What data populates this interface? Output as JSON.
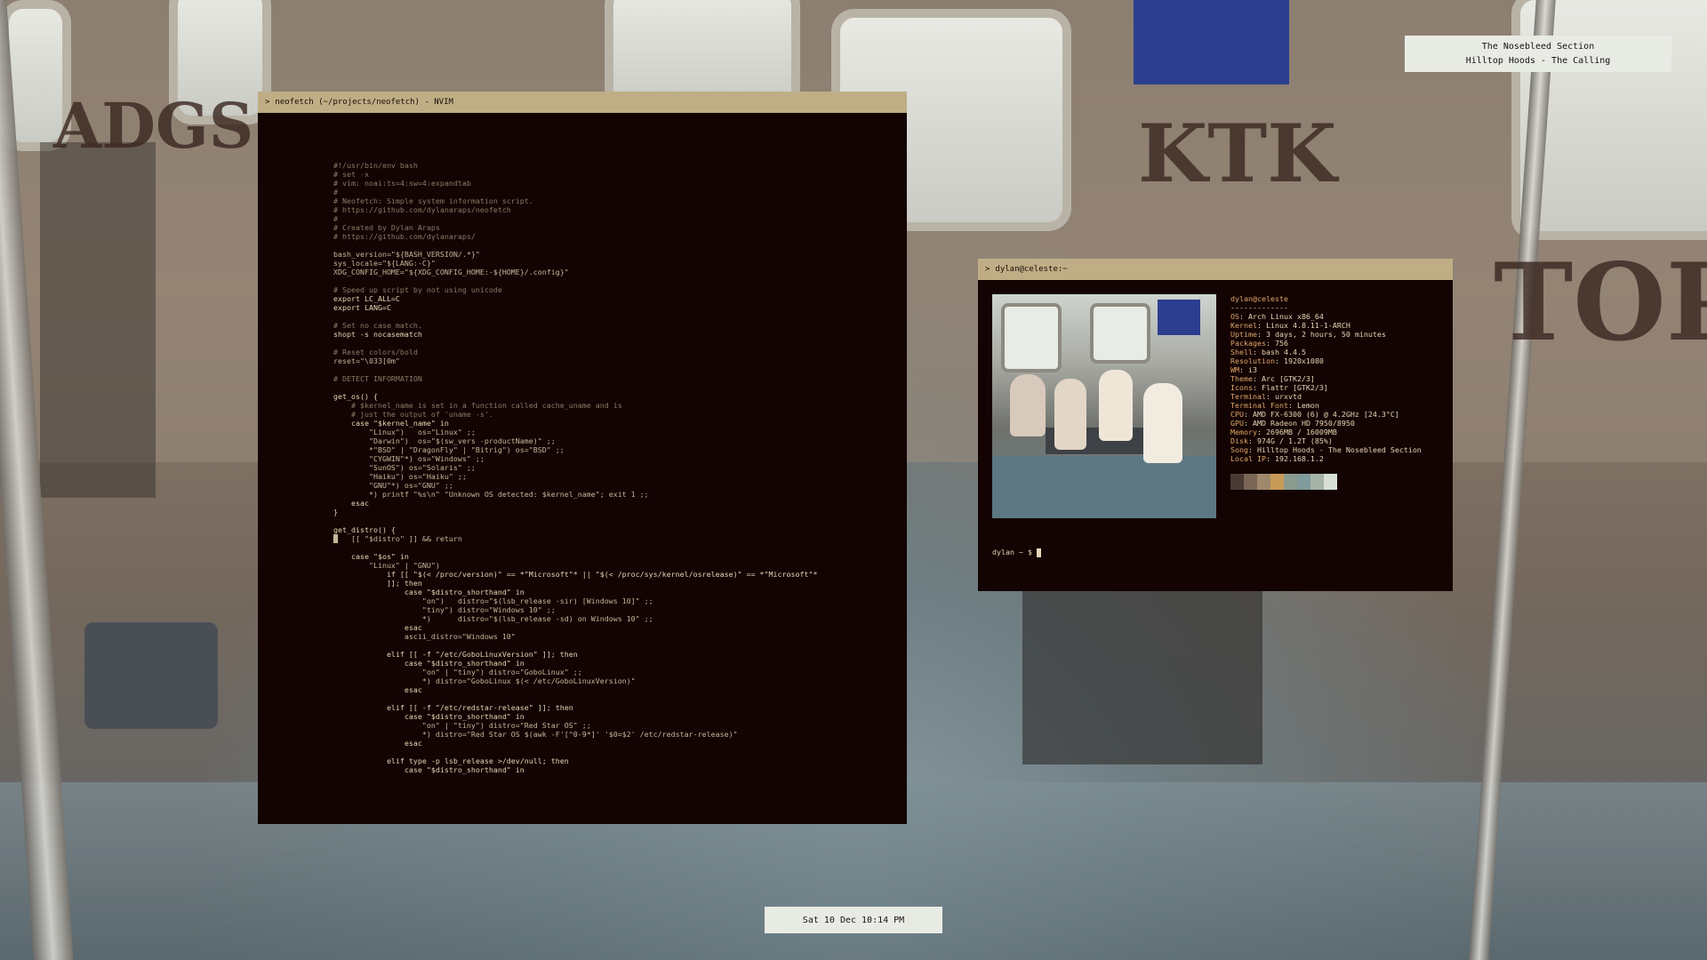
{
  "notification": {
    "line1": "The Nosebleed Section",
    "line2": "Hilltop Hoods - The Calling"
  },
  "clock": {
    "text": "Sat 10 Dec 10:14 PM"
  },
  "nvim": {
    "title_prefix": ">",
    "title": "neofetch (~/projects/neofetch) - NVIM"
  },
  "terminal": {
    "title_prefix": ">",
    "title": "dylan@celeste:~",
    "user_host": "dylan@celeste",
    "separator": "-------------",
    "info": [
      {
        "key": "OS",
        "value": "Arch Linux x86_64"
      },
      {
        "key": "Kernel",
        "value": "Linux 4.8.11-1-ARCH"
      },
      {
        "key": "Uptime",
        "value": "3 days, 2 hours, 50 minutes"
      },
      {
        "key": "Packages",
        "value": "756"
      },
      {
        "key": "Shell",
        "value": "bash 4.4.5"
      },
      {
        "key": "Resolution",
        "value": "1920x1080"
      },
      {
        "key": "WM",
        "value": "i3"
      },
      {
        "key": "Theme",
        "value": "Arc [GTK2/3]"
      },
      {
        "key": "Icons",
        "value": "Flattr [GTK2/3]"
      },
      {
        "key": "Terminal",
        "value": "urxvtd"
      },
      {
        "key": "Terminal Font",
        "value": "Lemon"
      },
      {
        "key": "CPU",
        "value": "AMD FX-6300 (6) @ 4.2GHz [24.3°C]"
      },
      {
        "key": "GPU",
        "value": "AMD Radeon HD 7950/8950"
      },
      {
        "key": "Memory",
        "value": "2696MB / 16009MB"
      },
      {
        "key": "Disk",
        "value": "974G / 1.2T (85%)"
      },
      {
        "key": "Song",
        "value": "Hilltop Hoods - The Nosebleed Section"
      },
      {
        "key": "Local IP",
        "value": "192.168.1.2"
      }
    ],
    "palette": [
      "#4a3a34",
      "#7a6656",
      "#a0886c",
      "#c89a58",
      "#8a9a8e",
      "#7f9a9a",
      "#a6b4a8",
      "#d8e0d6"
    ],
    "prompt": "dylan ~ $"
  },
  "code_lines": [
    "#!/usr/bin/env bash",
    "# set -x",
    "# vim: noai:ts=4:sw=4:expandtab",
    "#",
    "# Neofetch: Simple system information script.",
    "# https://github.com/dylanaraps/neofetch",
    "#",
    "# Created by Dylan Araps",
    "# https://github.com/dylanaraps/",
    "",
    "bash_version=\"${BASH_VERSION/.*}\"",
    "sys_locale=\"${LANG:-C}\"",
    "XDG_CONFIG_HOME=\"${XDG_CONFIG_HOME:-${HOME}/.config}\"",
    "",
    "# Speed up script by not using unicode",
    "export LC_ALL=C",
    "export LANG=C",
    "",
    "# Set no case match.",
    "shopt -s nocasematch",
    "",
    "# Reset colors/bold",
    "reset=\"\\033[0m\"",
    "",
    "# DETECT INFORMATION",
    "",
    "get_os() {",
    "    # $kernel_name is set in a function called cache_uname and is",
    "    # just the output of 'uname -s'.",
    "    case \"$kernel_name\" in",
    "        \"Linux\")   os=\"Linux\" ;;",
    "        \"Darwin\")  os=\"$(sw_vers -productName)\" ;;",
    "        *\"BSD\" | \"DragonFly\" | \"Bitrig\") os=\"BSD\" ;;",
    "        \"CYGWIN\"*) os=\"Windows\" ;;",
    "        \"SunOS\") os=\"Solaris\" ;;",
    "        \"Haiku\") os=\"Haiku\" ;;",
    "        \"GNU\"*) os=\"GNU\" ;;",
    "        *) printf \"%s\\n\" \"Unknown OS detected: $kernel_name\"; exit 1 ;;",
    "    esac",
    "}",
    "",
    "get_distro() {",
    "█   [[ \"$distro\" ]] && return",
    "",
    "    case \"$os\" in",
    "        \"Linux\" | \"GNU\")",
    "            if [[ \"$(< /proc/version)\" == *\"Microsoft\"* || \"$(< /proc/sys/kernel/osrelease)\" == *\"Microsoft\"*",
    "            ]]; then",
    "                case \"$distro_shorthand\" in",
    "                    \"on\")   distro=\"$(lsb_release -sir) [Windows 10]\" ;;",
    "                    \"tiny\") distro=\"Windows 10\" ;;",
    "                    *)      distro=\"$(lsb_release -sd) on Windows 10\" ;;",
    "                esac",
    "                ascii_distro=\"Windows 10\"",
    "",
    "            elif [[ -f \"/etc/GoboLinuxVersion\" ]]; then",
    "                case \"$distro_shorthand\" in",
    "                    \"on\" | \"tiny\") distro=\"GoboLinux\" ;;",
    "                    *) distro=\"GoboLinux $(< /etc/GoboLinuxVersion)\"",
    "                esac",
    "",
    "            elif [[ -f \"/etc/redstar-release\" ]]; then",
    "                case \"$distro_shorthand\" in",
    "                    \"on\" | \"tiny\") distro=\"Red Star OS\" ;;",
    "                    *) distro=\"Red Star OS $(awk -F'[^0-9*]' '$0=$2' /etc/redstar-release)\"",
    "                esac",
    "",
    "            elif type -p lsb_release >/dev/null; then",
    "                case \"$distro_shorthand\" in"
  ]
}
